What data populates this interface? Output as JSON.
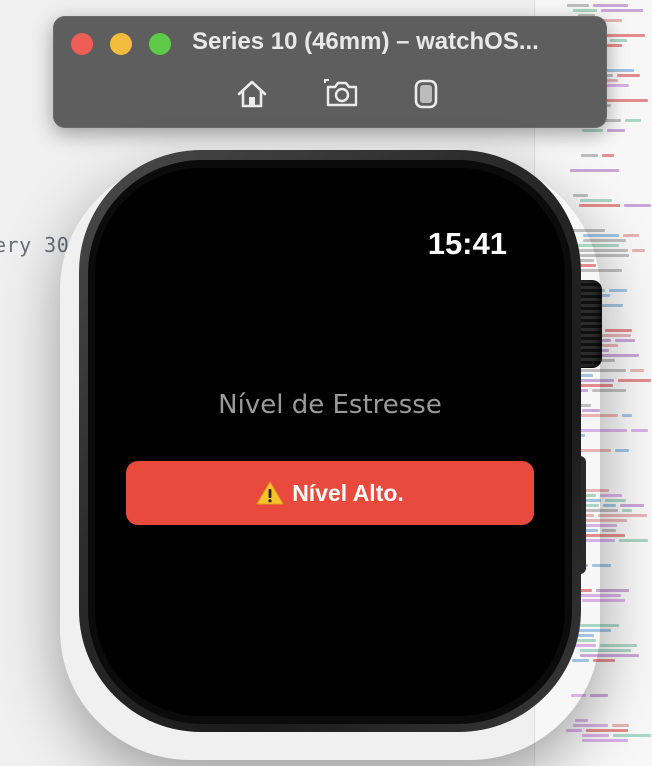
{
  "editor": {
    "code_fragment": "ery 30"
  },
  "simulator": {
    "title": "Series 10 (46mm) – watchOS...",
    "toolbar": {
      "home_icon": "home-icon",
      "screenshot_icon": "camera-icon",
      "rotate_icon": "device-rotate-icon"
    },
    "traffic_colors": {
      "close": "#ee5e56",
      "minimize": "#f2bd3c",
      "maximize": "#5fca48"
    }
  },
  "watch": {
    "time": "15:41",
    "stress_label": "Nível de Estresse",
    "alert": {
      "icon": "⚠️",
      "label": "Nível Alto.",
      "color": "#e84b3e"
    }
  }
}
